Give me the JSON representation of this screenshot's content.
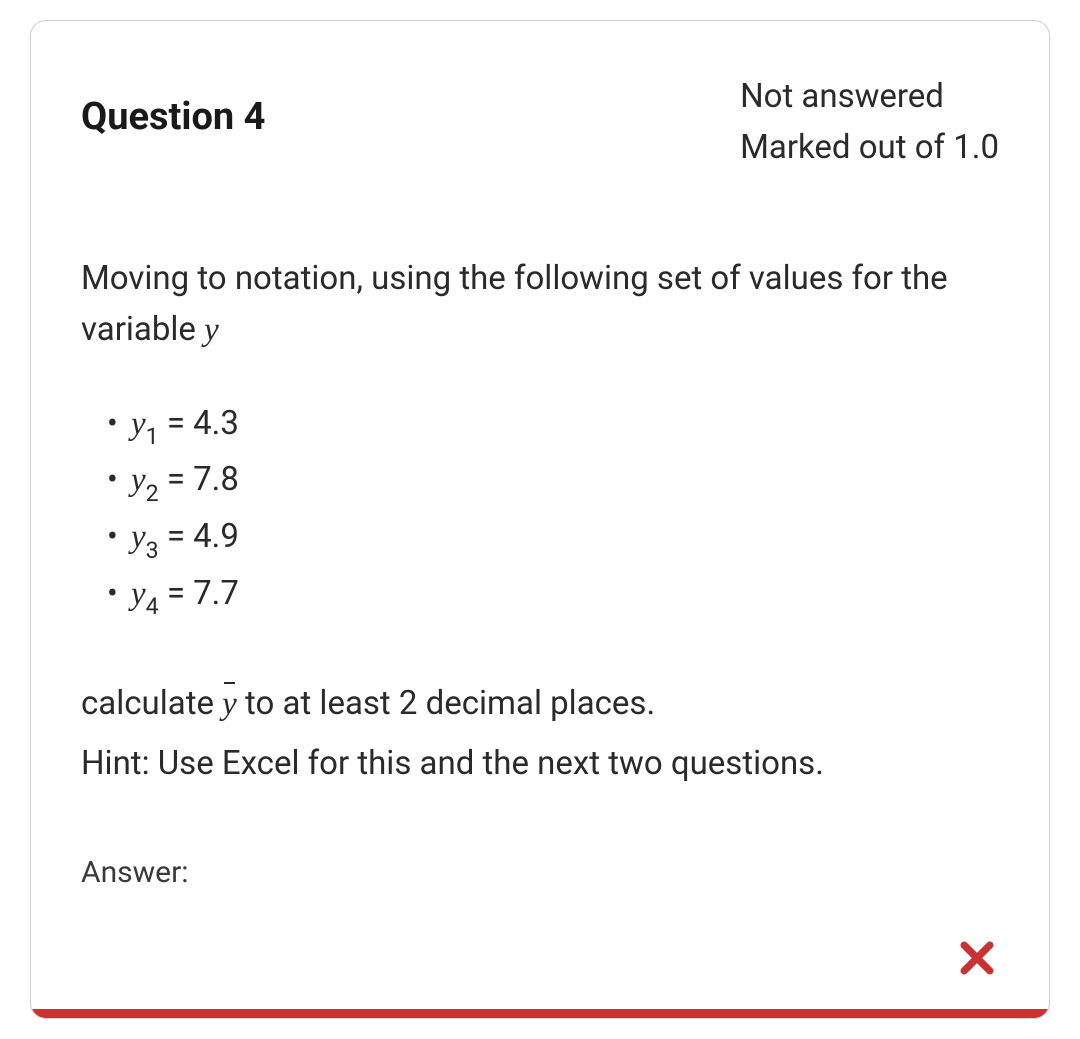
{
  "header": {
    "title": "Question 4",
    "status": "Not answered",
    "marks": "Marked out of 1.0"
  },
  "body": {
    "intro_prefix": "Moving to notation, using the following set of values for the variable ",
    "variable": "y",
    "values": [
      {
        "symbol": "y",
        "sub": "1",
        "value": "4.3"
      },
      {
        "symbol": "y",
        "sub": "2",
        "value": "7.8"
      },
      {
        "symbol": "y",
        "sub": "3",
        "value": "4.9"
      },
      {
        "symbol": "y",
        "sub": "4",
        "value": "7.7"
      }
    ],
    "calc_prefix": "calculate ",
    "ybar": "y",
    "calc_suffix": " to at least 2 decimal places.",
    "hint": "Hint: Use Excel for this and the next two questions.",
    "answer_label": "Answer:"
  },
  "colors": {
    "accent": "#c83232"
  }
}
